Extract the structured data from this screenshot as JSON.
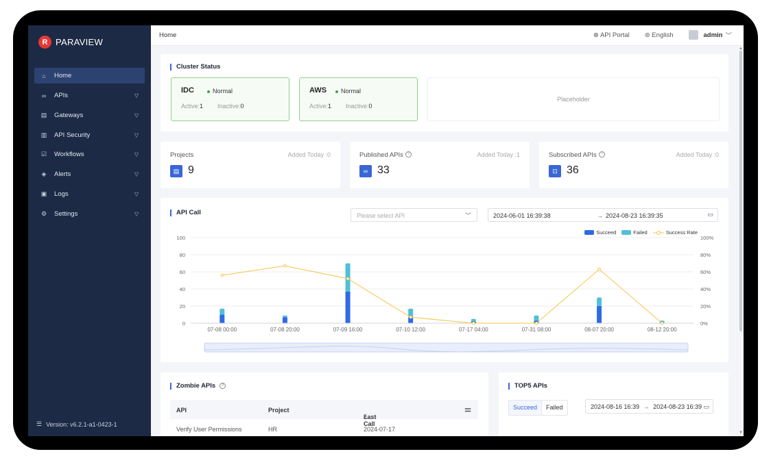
{
  "brand": {
    "name": "PARAVIEW",
    "logo_letter": "R"
  },
  "sidebar": {
    "items": [
      {
        "label": "Home",
        "icon": "home-icon",
        "active": true
      },
      {
        "label": "APIs",
        "icon": "link-icon"
      },
      {
        "label": "Gateways",
        "icon": "gateway-icon"
      },
      {
        "label": "API Security",
        "icon": "security-icon"
      },
      {
        "label": "Workflows",
        "icon": "workflow-icon"
      },
      {
        "label": "Alerts",
        "icon": "alert-icon"
      },
      {
        "label": "Logs",
        "icon": "log-icon"
      },
      {
        "label": "Settings",
        "icon": "settings-icon"
      }
    ],
    "version": "Version: v6.2.1-a1-0423-1"
  },
  "topbar": {
    "breadcrumb": "Home",
    "api_portal": "API Portal",
    "language": "English",
    "user": "admin"
  },
  "cluster": {
    "title": "Cluster Status",
    "items": [
      {
        "name": "IDC",
        "status": "Normal",
        "active_label": "Active:",
        "active": "1",
        "inactive_label": "Inactive:",
        "inactive": "0"
      },
      {
        "name": "AWS",
        "status": "Normal",
        "active_label": "Active:",
        "active": "1",
        "inactive_label": "Inactive:",
        "inactive": "0"
      }
    ],
    "placeholder": "Placeholder"
  },
  "stats": [
    {
      "label": "Projects",
      "today": "Added Today :0",
      "value": "9",
      "icon": "project-icon"
    },
    {
      "label": "Published APIs",
      "today": "Added Today :1",
      "value": "33",
      "icon": "link-icon"
    },
    {
      "label": "Subscribed APIs",
      "today": "Added Today :0",
      "value": "36",
      "icon": "bookmark-icon"
    }
  ],
  "api_call": {
    "title": "API Call",
    "select_placeholder": "Please select API",
    "date_start": "2024-06-01 16:39:38",
    "date_end": "2024-08-23 16:39:35"
  },
  "chart_data": {
    "type": "bar",
    "categories": [
      "07-08 00:00",
      "07-08 20:00",
      "07-09 16:00",
      "07-10 12:00",
      "07-17 04:00",
      "07-31 08:00",
      "08-07 20:00",
      "08-12 20:00"
    ],
    "series": [
      {
        "name": "Succeed",
        "values": [
          10,
          7,
          37,
          7,
          2,
          3,
          20,
          1
        ]
      },
      {
        "name": "Failed",
        "values": [
          7,
          2,
          33,
          10,
          3,
          6,
          10,
          2
        ]
      },
      {
        "name": "Success Rate",
        "values": [
          56,
          67,
          52,
          7,
          0,
          0,
          63,
          0
        ]
      }
    ],
    "ylim": [
      0,
      100
    ],
    "y_ticks": [
      "0",
      "20",
      "40",
      "60",
      "80",
      "100"
    ],
    "y2lim": [
      0,
      100
    ],
    "y2_ticks": [
      "0%",
      "20%",
      "40%",
      "60%",
      "80%",
      "100%"
    ],
    "legend": "top-right",
    "colors": {
      "succeed": "#2f6ae6",
      "failed": "#4fc0d8",
      "rate": "#f5c445"
    }
  },
  "zombie": {
    "title": "Zombie APIs",
    "columns": [
      "API",
      "Project",
      "Last Call"
    ],
    "rows": [
      {
        "api": "Verify User Permissions",
        "project": "HR",
        "last_call": "2024-07-17"
      }
    ]
  },
  "top5": {
    "title": "TOP5 APIs",
    "tab_succeed": "Succeed",
    "tab_failed": "Failed",
    "date_start": "2024-08-16 16:39",
    "date_end": "2024-08-23 16:39"
  }
}
